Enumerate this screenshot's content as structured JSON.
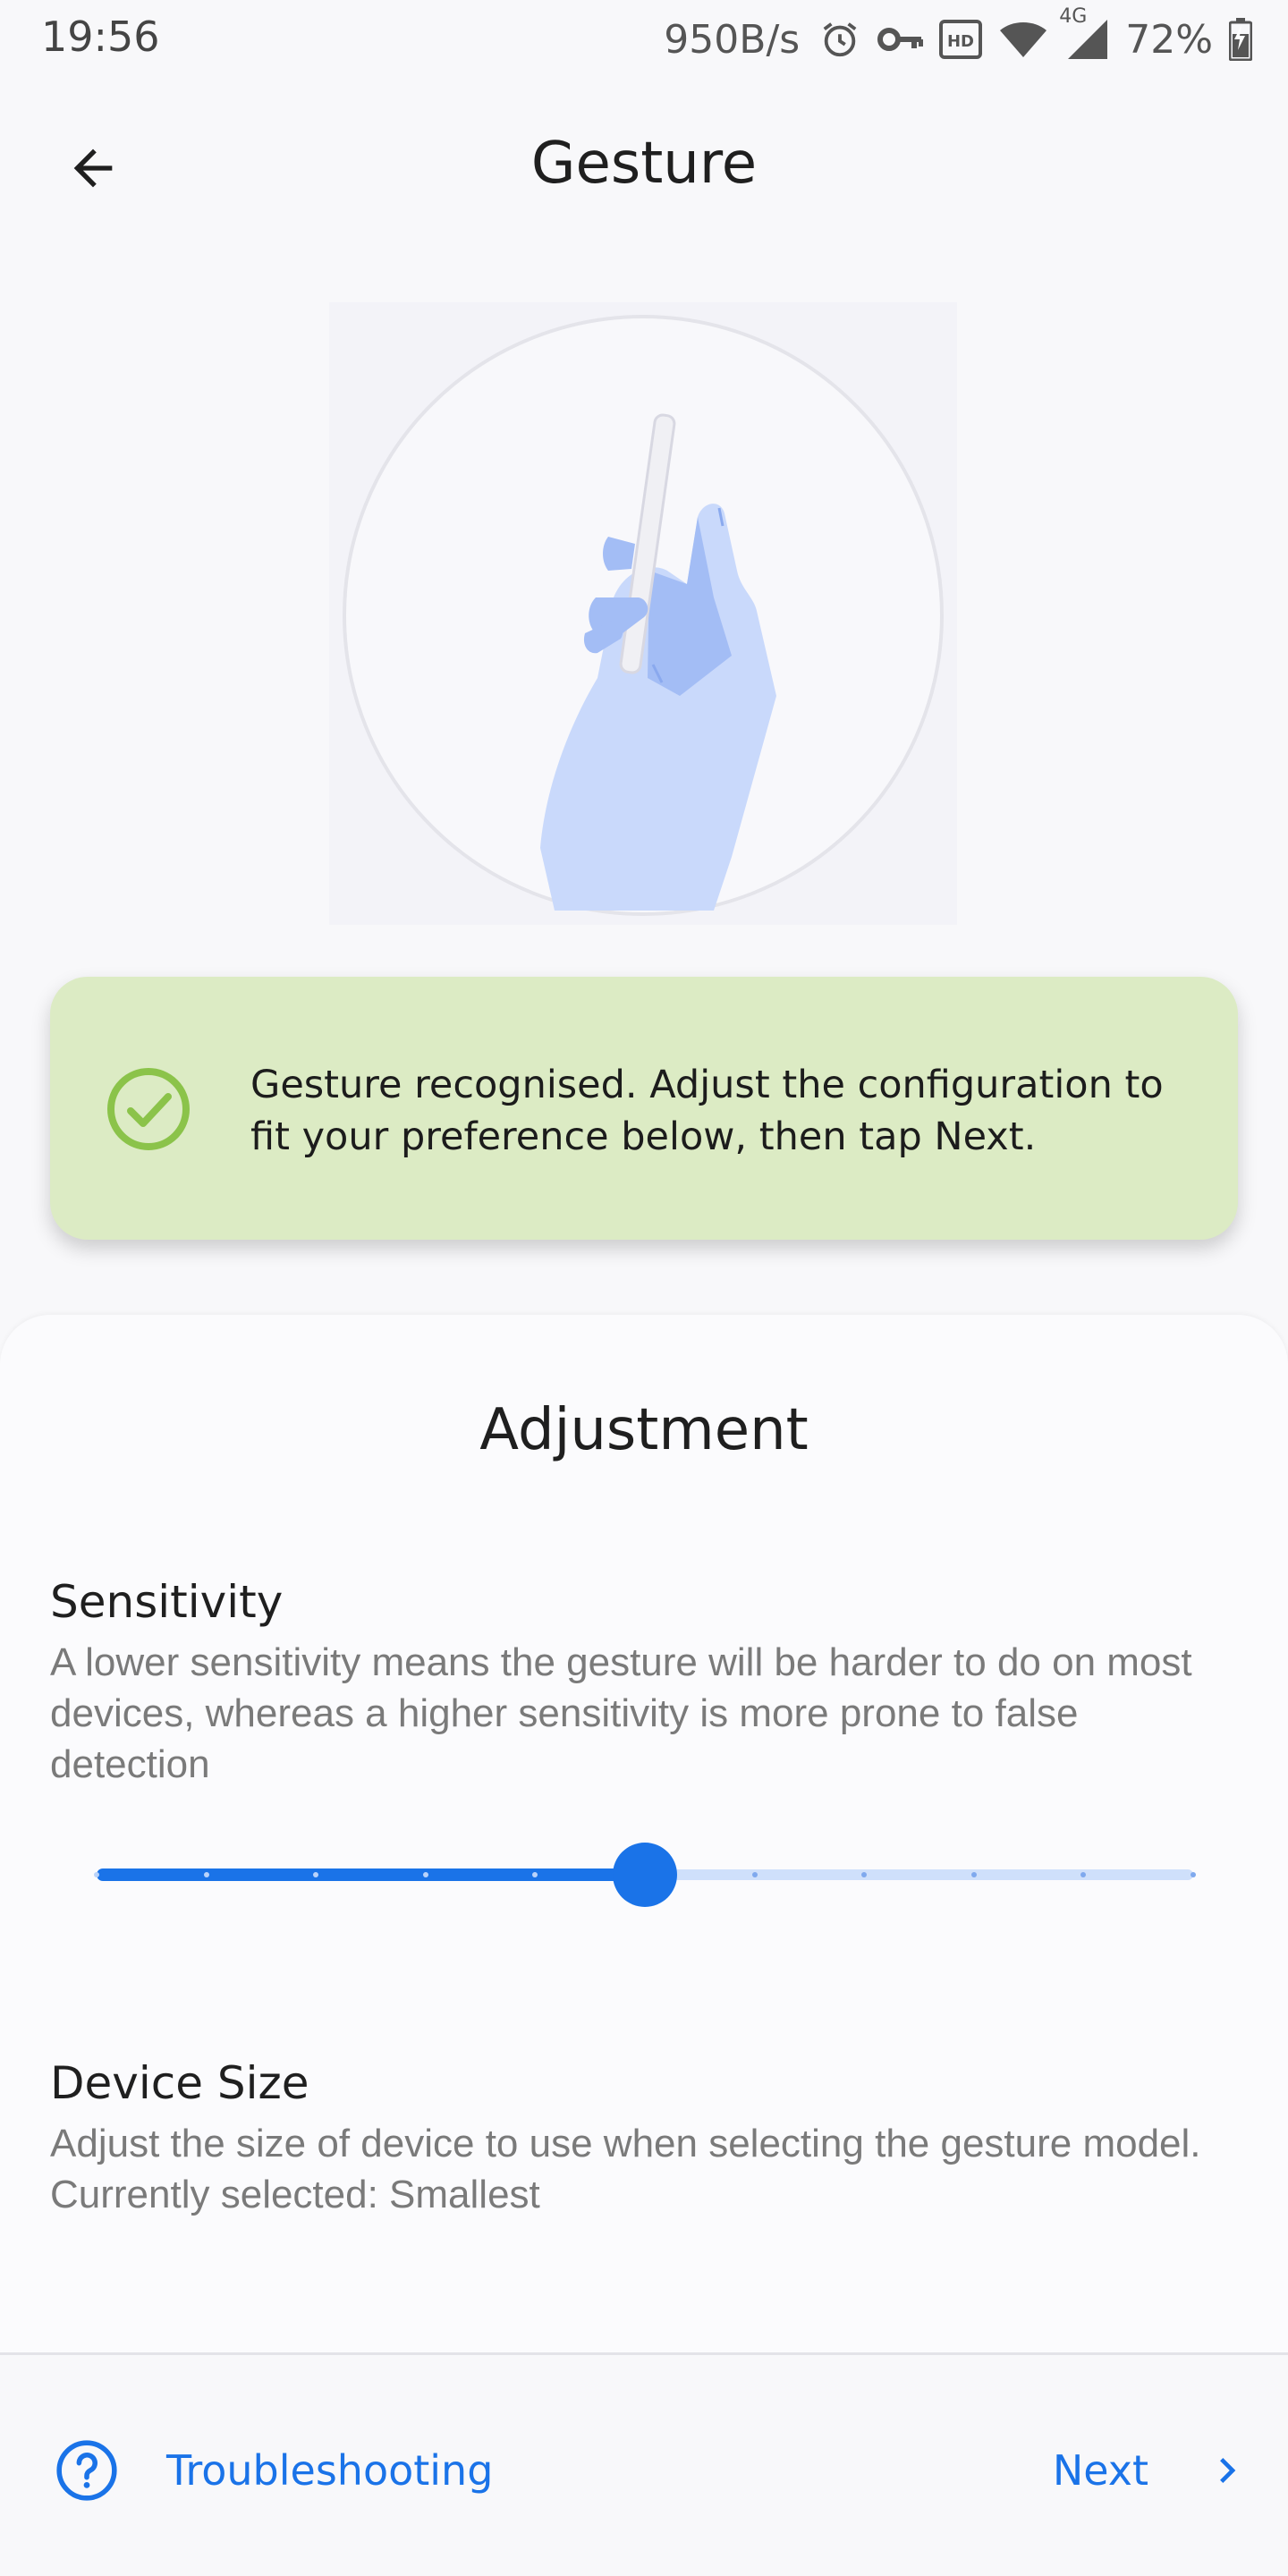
{
  "status_bar": {
    "time": "19:56",
    "network_speed": "950B/s",
    "network_type": "4G",
    "battery": "72%",
    "icons": [
      "alarm-icon",
      "vpn-key-icon",
      "hd-icon",
      "wifi-icon",
      "cell-signal-icon",
      "battery-charging-icon"
    ]
  },
  "header": {
    "title": "Gesture",
    "back_icon": "arrow-back-icon"
  },
  "illustration": {
    "name": "hand-holding-phone-illustration",
    "colors": {
      "hand": "#c9d9fb",
      "hand_shadow": "#a3bdf5",
      "circle_border": "#e4e4ea",
      "background": "#f3f3f8"
    }
  },
  "info_card": {
    "icon": "check-circle-icon",
    "message": "Gesture recognised. Adjust the configuration to fit your preference below, then tap Next.",
    "colors": {
      "background": "#dcebc4",
      "icon": "#8bc34a"
    }
  },
  "adjustment": {
    "title": "Adjustment",
    "sensitivity": {
      "title": "Sensitivity",
      "description": "A lower sensitivity means the gesture will be harder to do on most devices, whereas a higher sensitivity is more prone to false detection",
      "slider": {
        "min": 0,
        "max": 10,
        "step": 1,
        "value": 5
      }
    },
    "device_size": {
      "title": "Device Size",
      "description": "Adjust the size of device to use when selecting the gesture model. Currently selected: Smallest"
    }
  },
  "footer": {
    "troubleshooting_label": "Troubleshooting",
    "troubleshooting_icon": "help-circle-icon",
    "next_label": "Next",
    "next_icon": "chevron-right-icon"
  },
  "colors": {
    "accent": "#1a73e8",
    "accent_light": "#cfe0fb",
    "background": "#f8f8fa"
  }
}
